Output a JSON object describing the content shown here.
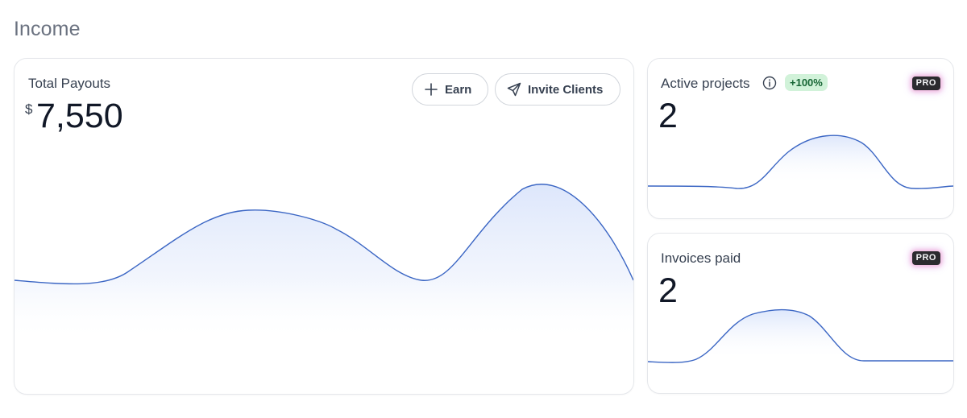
{
  "page": {
    "title": "Income"
  },
  "payouts": {
    "label": "Total Payouts",
    "currency": "$",
    "value": "7,550",
    "earn_label": "Earn",
    "invite_label": "Invite Clients"
  },
  "active_projects": {
    "label": "Active projects",
    "value": "2",
    "change_badge": "+100%",
    "plan_badge": "PRO"
  },
  "invoices": {
    "label": "Invoices paid",
    "value": "2",
    "plan_badge": "PRO"
  },
  "icons": [
    "plus-icon",
    "paper-plane-icon",
    "info-icon"
  ],
  "colors": {
    "line": "#3b66c4",
    "fill": "#dbe5fb",
    "growth_badge_bg": "#d1f2d9",
    "growth_badge_text": "#166534",
    "pro_badge_bg": "#2b2b2f"
  }
}
